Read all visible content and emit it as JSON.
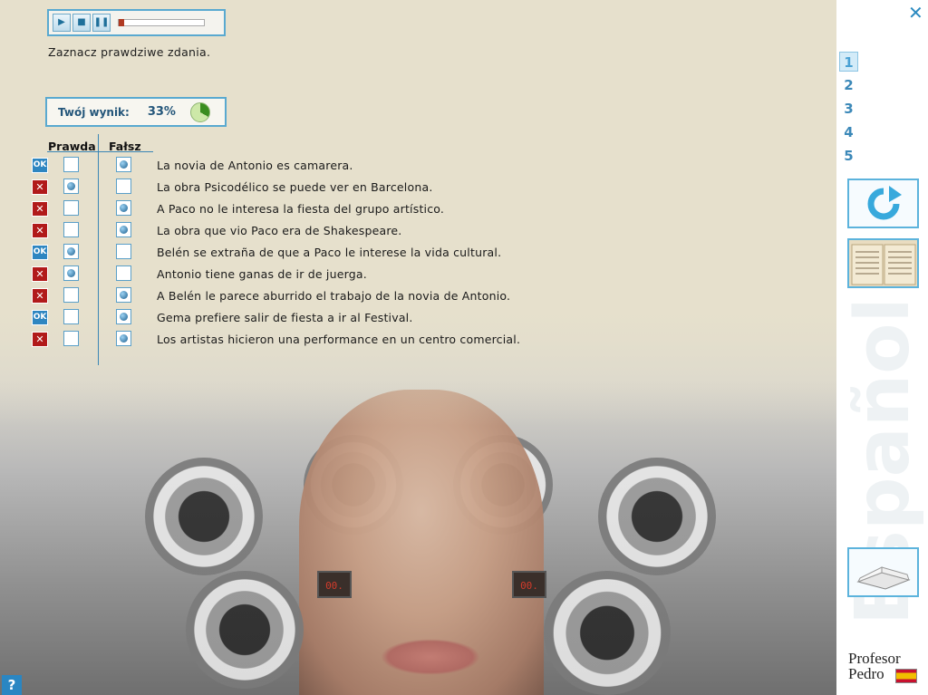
{
  "player": {
    "play_icon": "play-icon",
    "stop_icon": "stop-icon",
    "pause_icon": "pause-icon"
  },
  "instruction": "Zaznacz prawdziwe zdania.",
  "score": {
    "label": "Twój wynik:",
    "value": "33%",
    "fraction": 0.33
  },
  "table": {
    "col_true": "Prawda",
    "col_false": "Fałsz",
    "rows": [
      {
        "status": "OK",
        "true_checked": false,
        "false_checked": true,
        "text": "La novia  de Antonio  es camarera."
      },
      {
        "status": "✕",
        "true_checked": true,
        "false_checked": false,
        "text": "La obra  Psicodélico  se  puede ver  en Barcelona."
      },
      {
        "status": "✕",
        "true_checked": false,
        "false_checked": true,
        "text": "A Paco  no le  interesa la  fiesta del  grupo artístico."
      },
      {
        "status": "✕",
        "true_checked": false,
        "false_checked": true,
        "text": "La obra  que vio  Paco era  de Shakespeare."
      },
      {
        "status": "OK",
        "true_checked": true,
        "false_checked": false,
        "text": "Belén se  extraña de  que a  Paco le  interese la  vida cultural."
      },
      {
        "status": "✕",
        "true_checked": true,
        "false_checked": false,
        "text": "Antonio tiene  ganas de  ir de  juerga."
      },
      {
        "status": "✕",
        "true_checked": false,
        "false_checked": true,
        "text": "A Belén  le parece  aburrido el  trabajo de  la novia  de Antonio."
      },
      {
        "status": "OK",
        "true_checked": false,
        "false_checked": true,
        "text": "Gema prefiere  salir de  fiesta a  ir al  Festival."
      },
      {
        "status": "✕",
        "true_checked": false,
        "false_checked": true,
        "text": "Los artistas  hicieron una  performance en  un centro  comercial."
      }
    ]
  },
  "sidebar": {
    "close": "✕",
    "pages": [
      "1",
      "2",
      "3",
      "4",
      "5"
    ],
    "active_page": "1",
    "watermark": "Español",
    "brand_line1": "Profesor",
    "brand_line2": "Pedro"
  },
  "help": "?",
  "colors": {
    "accent": "#59a9d0",
    "ok": "#2e86c1",
    "wrong": "#b11a1a"
  }
}
